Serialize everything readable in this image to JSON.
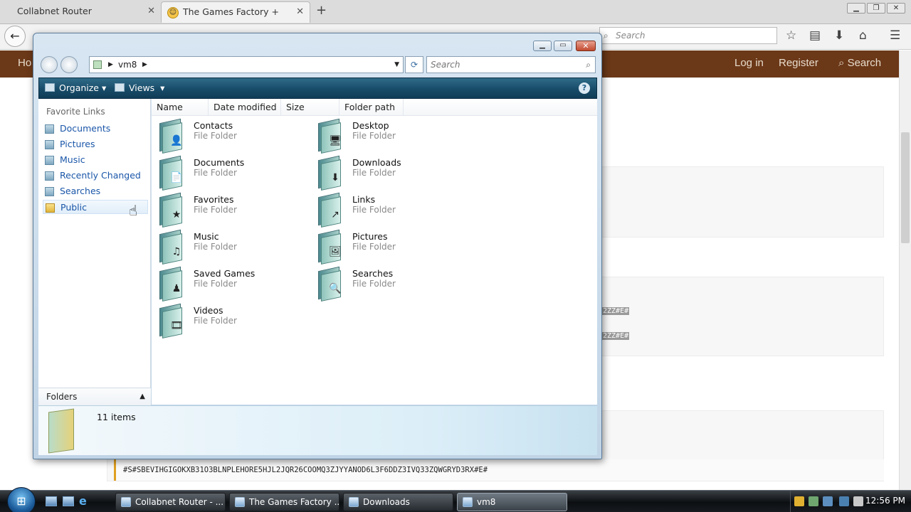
{
  "browser": {
    "tabs": [
      {
        "label": "Collabnet Router"
      },
      {
        "label": "The Games Factory + Install"
      }
    ],
    "search_placeholder": "Search"
  },
  "site": {
    "nav_left": "Ho",
    "login": "Log in",
    "register": "Register",
    "search": "Search",
    "selected_code_1": "2ZZ#E#",
    "selected_code_2": "2ZZ#E#",
    "code_line": "#S#SBEVIHGIGOKXB31O3BLNPLEHORE5HJL2JQR26COOMQ3ZJYYANOD6L3F6DDZ3IVQ33ZQWGRYD3RX#E#"
  },
  "explorer": {
    "path": "vm8",
    "search_placeholder": "Search",
    "toolbar": {
      "organize": "Organize",
      "views": "Views"
    },
    "favorites_header": "Favorite Links",
    "favorites": [
      {
        "label": "Documents"
      },
      {
        "label": "Pictures"
      },
      {
        "label": "Music"
      },
      {
        "label": "Recently Changed"
      },
      {
        "label": "Searches"
      },
      {
        "label": "Public"
      }
    ],
    "folders_header": "Folders",
    "columns": [
      "Name",
      "Date modified",
      "Size",
      "Folder path"
    ],
    "items": [
      {
        "name": "Contacts",
        "type": "File Folder",
        "icon": "contacts-folder-icon",
        "badge": "👤"
      },
      {
        "name": "Desktop",
        "type": "File Folder",
        "icon": "desktop-folder-icon",
        "badge": "🖥"
      },
      {
        "name": "Documents",
        "type": "File Folder",
        "icon": "documents-folder-icon",
        "badge": "📄"
      },
      {
        "name": "Downloads",
        "type": "File Folder",
        "icon": "downloads-folder-icon",
        "badge": "⬇"
      },
      {
        "name": "Favorites",
        "type": "File Folder",
        "icon": "favorites-folder-icon",
        "badge": "★"
      },
      {
        "name": "Links",
        "type": "File Folder",
        "icon": "links-folder-icon",
        "badge": "↗"
      },
      {
        "name": "Music",
        "type": "File Folder",
        "icon": "music-folder-icon",
        "badge": "♫"
      },
      {
        "name": "Pictures",
        "type": "File Folder",
        "icon": "pictures-folder-icon",
        "badge": "🖼"
      },
      {
        "name": "Saved Games",
        "type": "File Folder",
        "icon": "saved-games-folder-icon",
        "badge": "♟"
      },
      {
        "name": "Searches",
        "type": "File Folder",
        "icon": "searches-folder-icon",
        "badge": "🔍"
      },
      {
        "name": "Videos",
        "type": "File Folder",
        "icon": "videos-folder-icon",
        "badge": "🎞"
      }
    ],
    "status_count": "11 items"
  },
  "taskbar": {
    "tasks": [
      {
        "label": "Collabnet Router - ..."
      },
      {
        "label": "The Games Factory ..."
      },
      {
        "label": "Downloads"
      },
      {
        "label": "vm8"
      }
    ],
    "clock": "12:56 PM"
  },
  "colors": {
    "site_nav": "#6b3818",
    "explorer_toolbar": "#184c69",
    "link_blue": "#1a56a8"
  }
}
